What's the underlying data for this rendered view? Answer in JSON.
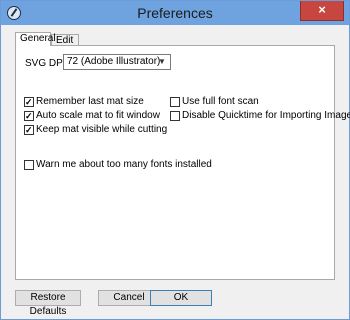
{
  "window": {
    "title": "Preferences",
    "close_label": "×"
  },
  "tabs": [
    {
      "label": "General",
      "active": true
    },
    {
      "label": "Edit",
      "active": false
    }
  ],
  "svg_dpi": {
    "label": "SVG DPI:",
    "value": "72 (Adobe Illustrator)"
  },
  "options_left": [
    {
      "label": "Remember last mat size",
      "checked": true
    },
    {
      "label": "Auto scale mat to fit window",
      "checked": true
    },
    {
      "label": "Keep mat visible while cutting",
      "checked": true
    }
  ],
  "options_right": [
    {
      "label": "Use full font scan",
      "checked": false
    },
    {
      "label": "Disable Quicktime for Importing Images",
      "checked": false
    }
  ],
  "option_warn": {
    "label": "Warn me about too many fonts installed",
    "checked": false
  },
  "buttons": {
    "restore_label": "Restore Defaults",
    "cancel_label": "Cancel",
    "ok_label": "OK"
  },
  "colors": {
    "titlebar": "#6fa3e0",
    "close": "#c7463f"
  }
}
